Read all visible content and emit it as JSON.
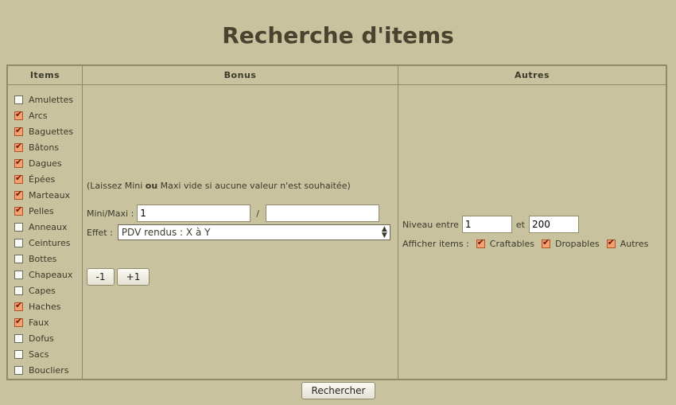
{
  "title": "Recherche d'items",
  "columns": {
    "items": "Items",
    "bonus": "Bonus",
    "autres": "Autres"
  },
  "items": [
    {
      "label": "Amulettes",
      "checked": false
    },
    {
      "label": "Arcs",
      "checked": true
    },
    {
      "label": "Baguettes",
      "checked": true
    },
    {
      "label": "Bâtons",
      "checked": true
    },
    {
      "label": "Dagues",
      "checked": true
    },
    {
      "label": "Épées",
      "checked": true
    },
    {
      "label": "Marteaux",
      "checked": true
    },
    {
      "label": "Pelles",
      "checked": true
    },
    {
      "label": "Anneaux",
      "checked": false
    },
    {
      "label": "Ceintures",
      "checked": false
    },
    {
      "label": "Bottes",
      "checked": false
    },
    {
      "label": "Chapeaux",
      "checked": false
    },
    {
      "label": "Capes",
      "checked": false
    },
    {
      "label": "Haches",
      "checked": true
    },
    {
      "label": "Faux",
      "checked": true
    },
    {
      "label": "Dofus",
      "checked": false
    },
    {
      "label": "Sacs",
      "checked": false
    },
    {
      "label": "Boucliers",
      "checked": false
    }
  ],
  "bonus": {
    "note_prefix": "(Laissez Mini ",
    "note_bold": "ou",
    "note_suffix": " Maxi vide si aucune valeur n'est souhaitée)",
    "minmax_label": "Mini/Maxi :",
    "min_value": "1",
    "max_value": "",
    "separator": "/",
    "effect_label": "Effet :",
    "effect_selected": "PDV rendus : X à Y",
    "minus_label": "-1",
    "plus_label": "+1"
  },
  "autres": {
    "level_label": "Niveau entre",
    "level_min": "1",
    "level_and": "et",
    "level_max": "200",
    "show_label": "Afficher items :",
    "filters": [
      {
        "label": "Craftables",
        "checked": true
      },
      {
        "label": "Dropables",
        "checked": true
      },
      {
        "label": "Autres",
        "checked": true
      }
    ]
  },
  "search_button": "Rechercher"
}
